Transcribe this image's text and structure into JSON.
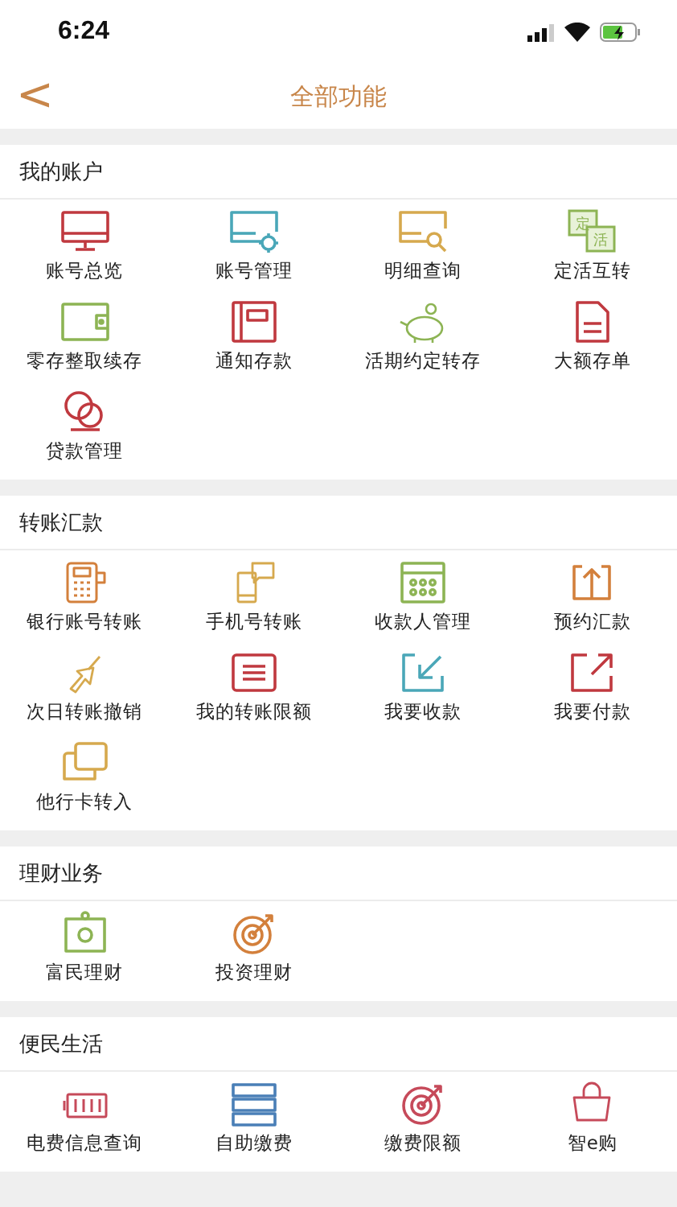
{
  "status_bar": {
    "time": "6:24"
  },
  "nav": {
    "back": "<",
    "title": "全部功能"
  },
  "sections": [
    {
      "title": "我的账户",
      "items": [
        {
          "label": "账号总览"
        },
        {
          "label": "账号管理"
        },
        {
          "label": "明细查询"
        },
        {
          "label": "定活互转",
          "icon_text": [
            "定",
            "活"
          ]
        },
        {
          "label": "零存整取续存"
        },
        {
          "label": "通知存款"
        },
        {
          "label": "活期约定转存"
        },
        {
          "label": "大额存单"
        },
        {
          "label": "贷款管理"
        }
      ]
    },
    {
      "title": "转账汇款",
      "items": [
        {
          "label": "银行账号转账"
        },
        {
          "label": "手机号转账"
        },
        {
          "label": "收款人管理"
        },
        {
          "label": "预约汇款"
        },
        {
          "label": "次日转账撤销"
        },
        {
          "label": "我的转账限额"
        },
        {
          "label": "我要收款"
        },
        {
          "label": "我要付款"
        },
        {
          "label": "他行卡转入"
        }
      ]
    },
    {
      "title": "理财业务",
      "items": [
        {
          "label": "富民理财"
        },
        {
          "label": "投资理财"
        }
      ]
    },
    {
      "title": "便民生活",
      "items": [
        {
          "label": "电费信息查询"
        },
        {
          "label": "自助缴费"
        },
        {
          "label": "缴费限额"
        },
        {
          "label": "智e购"
        }
      ]
    }
  ]
}
